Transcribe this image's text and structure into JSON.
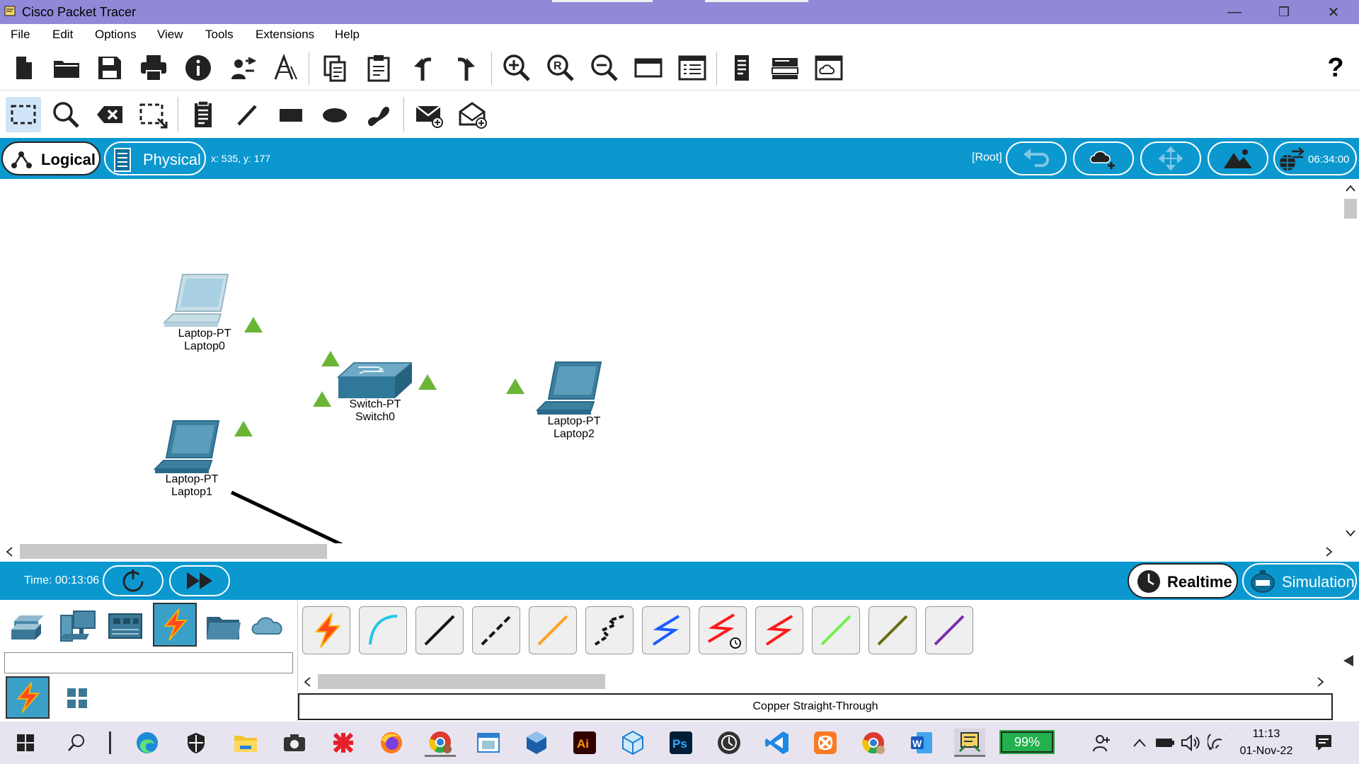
{
  "window": {
    "title": "Cisco Packet Tracer",
    "minimize": "—",
    "restore": "❐",
    "close": "✕"
  },
  "menu": [
    "File",
    "Edit",
    "Options",
    "View",
    "Tools",
    "Extensions",
    "Help"
  ],
  "toolbar_main": [
    "new-file-icon",
    "open-folder-icon",
    "save-icon",
    "print-icon",
    "info-icon",
    "activity-wizard-icon",
    "network-info-icon",
    "copy-icon",
    "paste-icon",
    "undo-icon",
    "redo-icon",
    "zoom-in-icon",
    "zoom-reset-icon",
    "zoom-out-icon",
    "drawing-palette-icon",
    "custom-device-dialog-icon",
    "viewport-icon",
    "pdu-list-icon",
    "cluster-icon"
  ],
  "toolbar_help": "?",
  "toolbar_secondary": [
    "select-icon",
    "inspect-icon",
    "delete-icon",
    "resize-icon",
    "note-icon",
    "draw-line-icon",
    "rectangle-icon",
    "ellipse-icon",
    "freeform-icon",
    "add-simple-pdu-icon",
    "add-complex-pdu-icon"
  ],
  "view_bar": {
    "logical_label": "Logical",
    "physical_label": "Physical",
    "coords": "x: 535, y: 177",
    "root_label": "[Root]",
    "clock": "06:34:00"
  },
  "devices": [
    {
      "type": "Laptop-PT",
      "name": "Laptop0"
    },
    {
      "type": "Laptop-PT",
      "name": "Laptop1"
    },
    {
      "type": "Switch-PT",
      "name": "Switch0"
    },
    {
      "type": "Laptop-PT",
      "name": "Laptop2"
    }
  ],
  "sim_bar": {
    "time_label": "Time: 00:13:06",
    "realtime_label": "Realtime",
    "simulation_label": "Simulation"
  },
  "device_categories": [
    "network-devices-icon",
    "end-devices-icon",
    "components-icon",
    "connections-icon",
    "miscellaneous-icon",
    "multiuser-icon"
  ],
  "connection_types": [
    "automatic",
    "console",
    "straight-through",
    "crossover",
    "fiber",
    "phone",
    "coaxial",
    "serial-dce",
    "serial-dte",
    "octal",
    "iot-custom",
    "usb"
  ],
  "selected_connection": "Copper Straight-Through",
  "taskbar": {
    "battery": "99%",
    "time": "11:13",
    "date": "01-Nov-22"
  },
  "colors": {
    "accent_blue": "#0b98cf",
    "title_purple": "#9089d8",
    "link_green": "#6bb536"
  }
}
